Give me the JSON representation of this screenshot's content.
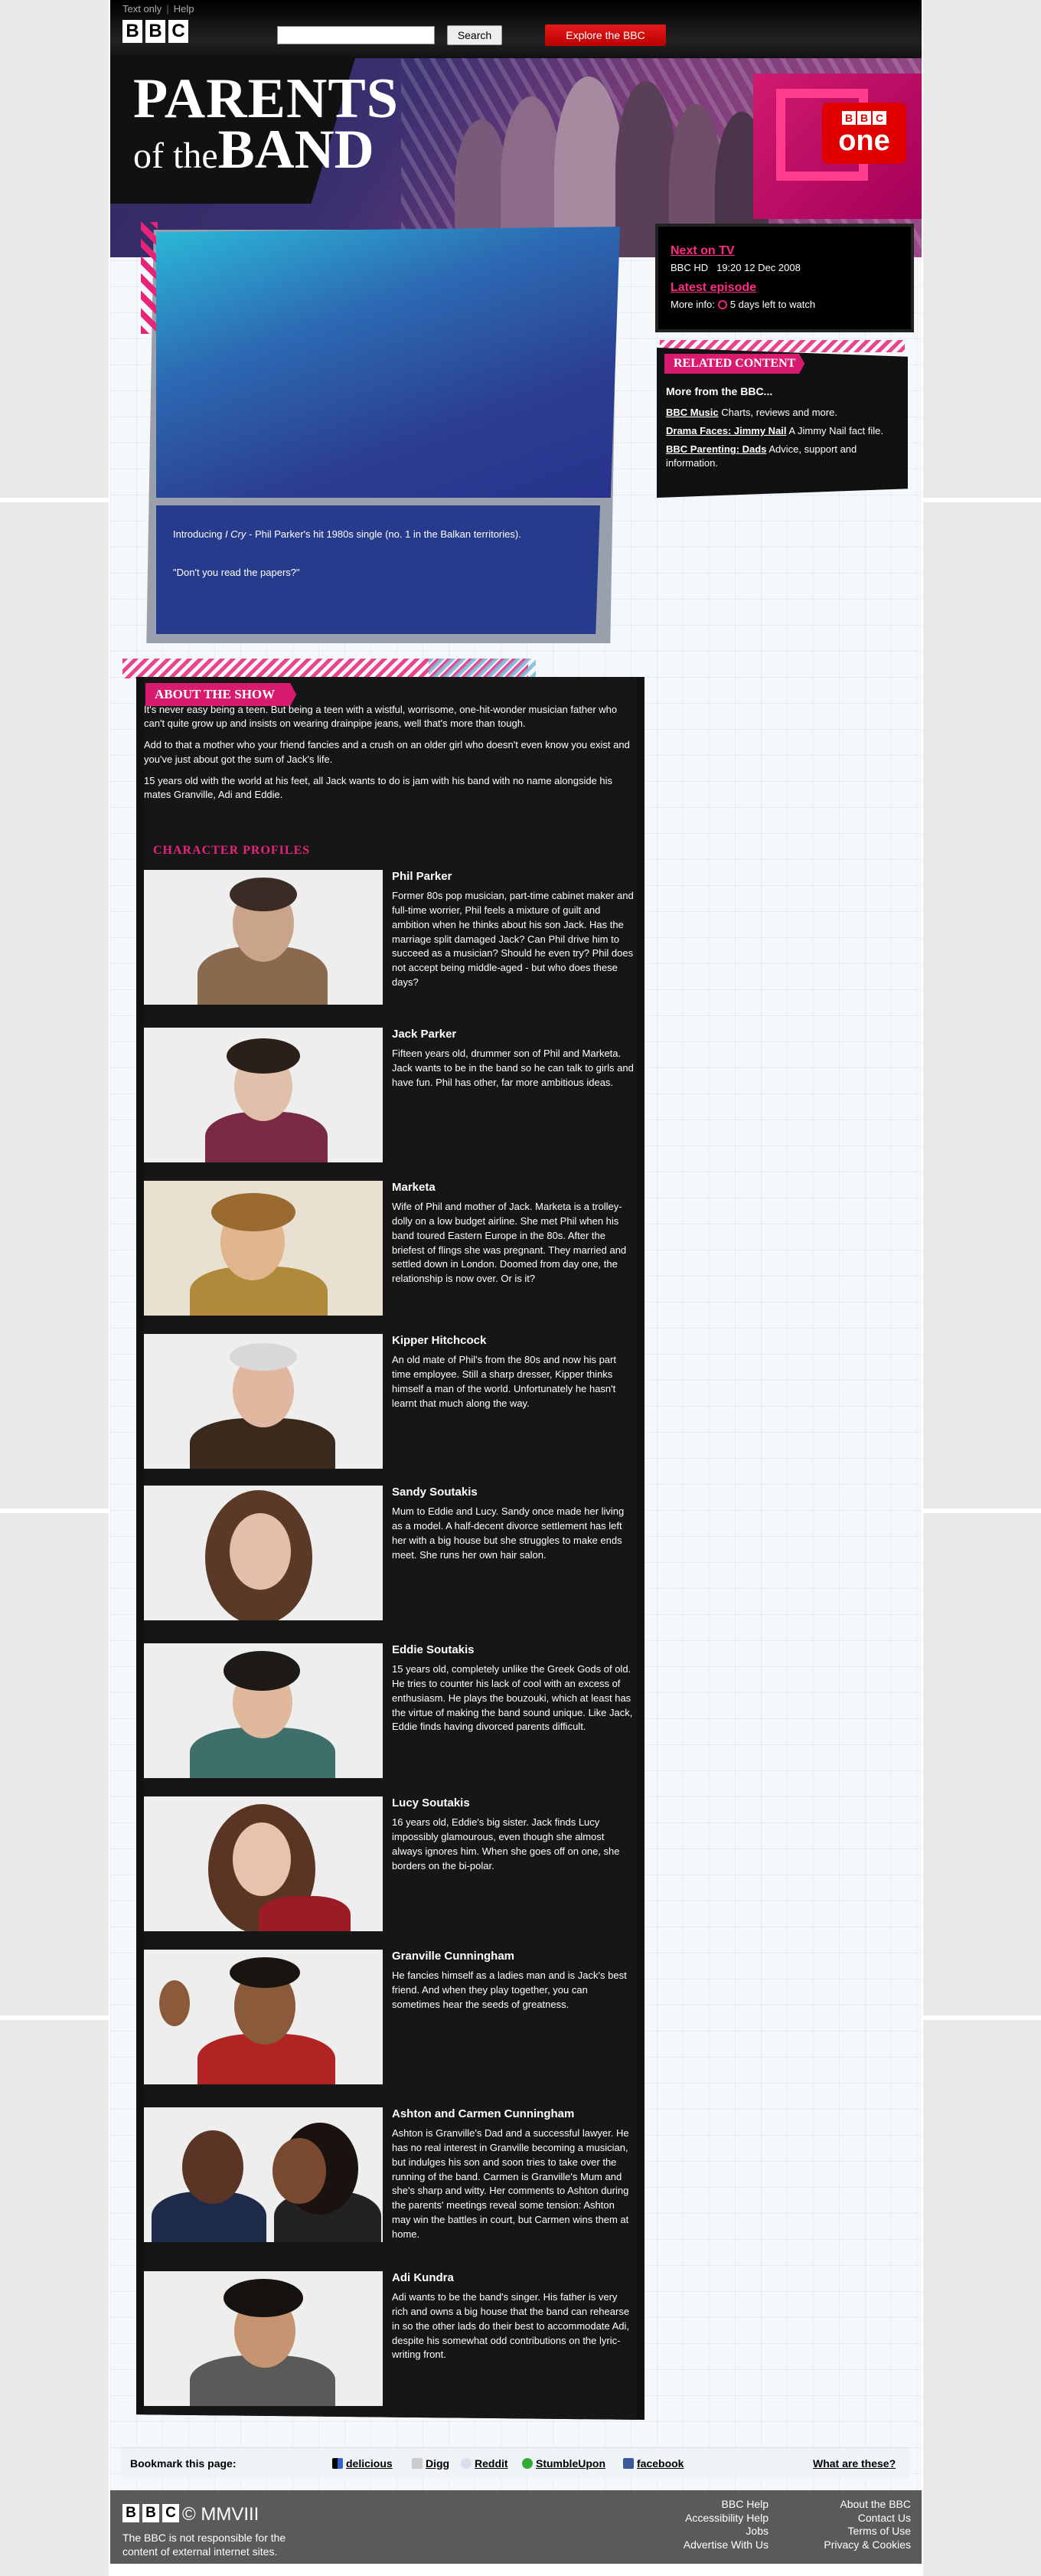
{
  "header": {
    "links": [
      "Text only",
      "Help"
    ],
    "logo_letters": [
      "B",
      "B",
      "C"
    ],
    "search_placeholder": "",
    "search_button": "Search",
    "explore_button": "Explore the BBC"
  },
  "banner": {
    "title_line1": "PARENTS",
    "title_line2": "of the",
    "title_line3": "BAND",
    "channel_letters": [
      "B",
      "B",
      "C"
    ],
    "channel_word": "one"
  },
  "player": {
    "caption_intro": "Introducing ",
    "caption_song": "I Cry",
    "caption_rest": " - Phil Parker's hit 1980s single (no. 1 in the Balkan territories).",
    "caption_quote": "\"Don't you read the papers?\""
  },
  "next_on_tv": {
    "title": "Next on TV",
    "channel": "BBC HD",
    "time": "19:20 12 Dec 2008",
    "latest_title": "Latest episode",
    "more_info_label": "More info:",
    "days_left": "5 days left to watch"
  },
  "related": {
    "title": "RELATED CONTENT",
    "subtitle": "More from the BBC...",
    "items": [
      {
        "link": "BBC Music",
        "text": " Charts, reviews and more."
      },
      {
        "link": "Drama Faces: Jimmy Nail",
        "text": " A Jimmy Nail fact file."
      },
      {
        "link": "BBC Parenting: Dads",
        "text": " Advice, support and information."
      }
    ]
  },
  "about": {
    "title": "ABOUT THE SHOW",
    "paragraphs": [
      "It's never easy being a teen. But being a teen with a wistful, worrisome, one-hit-wonder musician father who can't quite grow up and insists on wearing drainpipe jeans, well that's more than tough.",
      "Add to that a mother who your friend fancies and a crush on an older girl who doesn't even know you exist and you've just about got the sum of Jack's life.",
      "15 years old with the world at his feet, all Jack wants to do is jam with his band with no name alongside his mates Granville, Adi and Eddie."
    ]
  },
  "profiles": {
    "title": "CHARACTER PROFILES",
    "items": [
      {
        "name": "Phil Parker",
        "desc": "Former 80s pop musician, part-time cabinet maker and full-time worrier, Phil feels a mixture of guilt and ambition when he thinks about his son Jack. Has the marriage split damaged Jack? Can Phil drive him to succeed as a musician? Should he even try? Phil does not accept being middle-aged - but who does these days?"
      },
      {
        "name": "Jack Parker",
        "desc": "Fifteen years old, drummer son of Phil and Marketa. Jack wants to be in the band so he can talk to girls and have fun. Phil has other, far more ambitious ideas."
      },
      {
        "name": "Marketa",
        "desc": "Wife of Phil and mother of Jack. Marketa is a trolley-dolly on a low budget airline. She met Phil when his band toured Eastern Europe in the 80s. After the briefest of flings she was pregnant. They married and settled down in London. Doomed from day one, the relationship is now over. Or is it?"
      },
      {
        "name": "Kipper Hitchcock",
        "desc": "An old mate of Phil's from the 80s and now his part time employee. Still a sharp dresser, Kipper thinks himself a man of the world. Unfortunately he hasn't learnt that much along the way."
      },
      {
        "name": "Sandy Soutakis",
        "desc": "Mum to Eddie and Lucy. Sandy once made her living as a model. A half-decent divorce settlement has left her with a big house but she struggles to make ends meet. She runs her own hair salon."
      },
      {
        "name": "Eddie Soutakis",
        "desc": "15 years old, completely unlike the Greek Gods of old. He tries to counter his lack of cool with an excess of enthusiasm. He plays the bouzouki, which at least has the virtue of making the band sound unique. Like Jack, Eddie finds having divorced parents difficult."
      },
      {
        "name": "Lucy Soutakis",
        "desc": "16 years old, Eddie's big sister. Jack finds Lucy impossibly glamourous, even though she almost always ignores him. When she goes off on one, she borders on the bi-polar."
      },
      {
        "name": "Granville Cunningham",
        "desc": "He fancies himself as a ladies man and is Jack's best friend. And when they play together, you can sometimes hear the seeds of greatness."
      },
      {
        "name": "Ashton and Carmen Cunningham",
        "desc": "Ashton is Granville's Dad and a successful lawyer. He has no real interest in Granville becoming a musician, but indulges his son and soon tries to take over the running of the band. Carmen is Granville's Mum and she's sharp and witty. Her comments to Ashton during the parents' meetings reveal some tension: Ashton may win the battles in court, but Carmen wins them at home."
      },
      {
        "name": "Adi Kundra",
        "desc": "Adi wants to be the band's singer. His father is very rich and owns a big house that the band can rehearse in so the other lads do their best to accommodate Adi, despite his somewhat odd contributions on the lyric-writing front."
      }
    ]
  },
  "bookmark": {
    "label": "Bookmark this page:",
    "services": [
      "delicious",
      "Digg",
      "Reddit",
      "StumbleUpon",
      "facebook"
    ],
    "what": "What are these?"
  },
  "footer": {
    "copyright": "© MMVIII",
    "note": "The BBC is not responsible for the content of external internet sites.",
    "col1": [
      "BBC Help",
      "Accessibility Help",
      "Jobs",
      "Advertise With Us"
    ],
    "col2": [
      "About the BBC",
      "Contact Us",
      "Terms of Use",
      "Privacy & Cookies"
    ]
  },
  "colors": {
    "accent": "#e8247a",
    "panel": "#161616",
    "player": "#2b3e93",
    "footer": "#5a5a5a"
  }
}
